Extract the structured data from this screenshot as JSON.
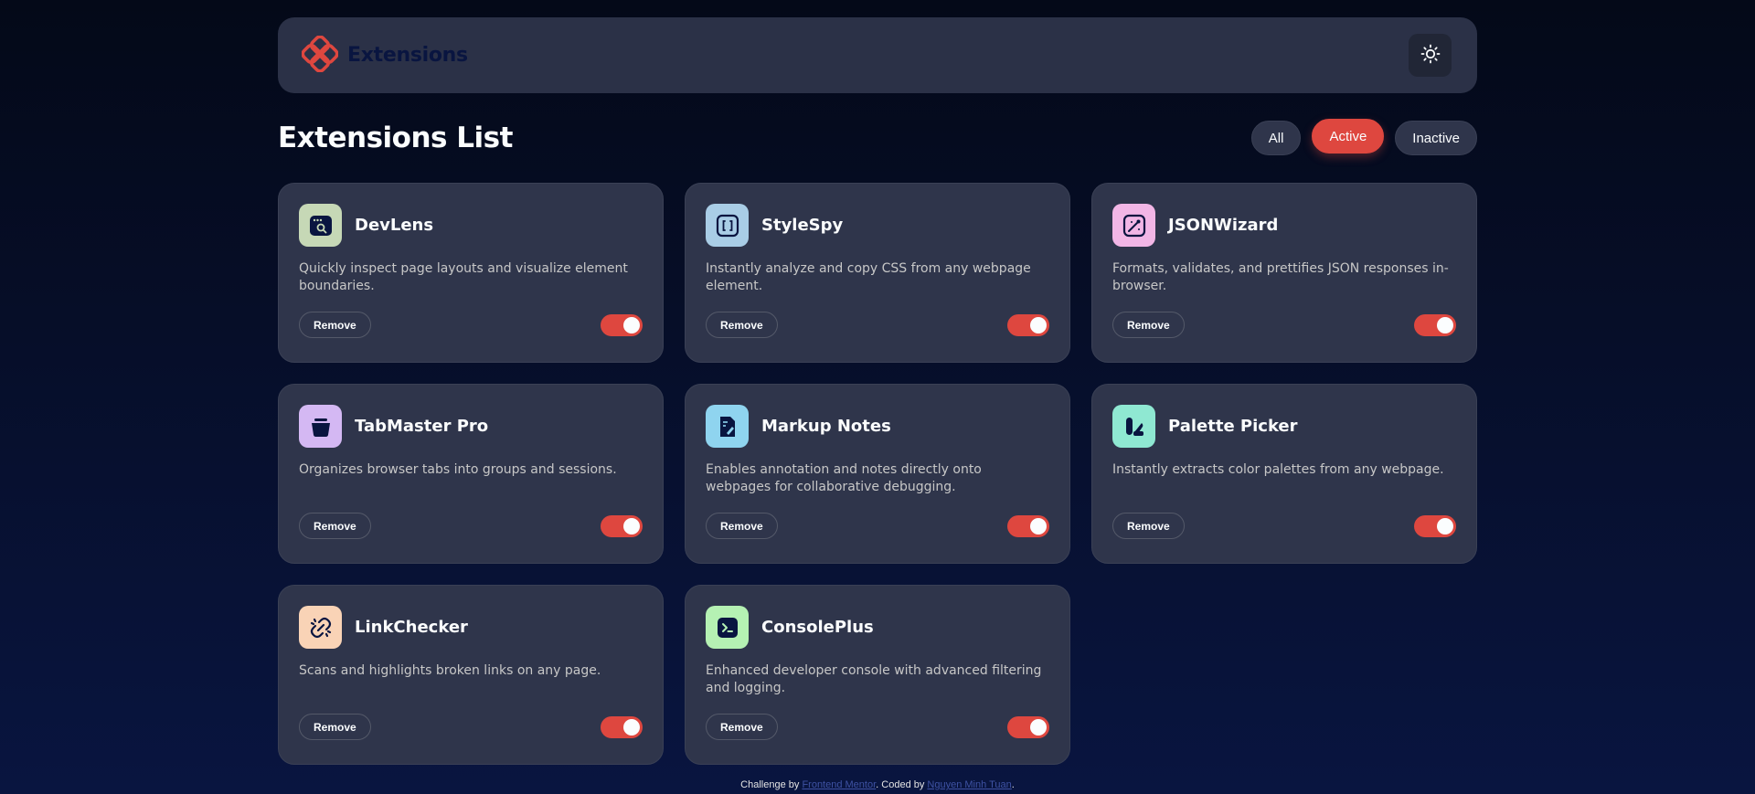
{
  "header": {
    "brand": "Extensions",
    "logo_icon": "extensions-logo-icon",
    "theme_icon": "sun-icon"
  },
  "page": {
    "title": "Extensions List"
  },
  "filters": [
    {
      "label": "All",
      "active": false
    },
    {
      "label": "Active",
      "active": true
    },
    {
      "label": "Inactive",
      "active": false
    }
  ],
  "extensions": [
    {
      "name": "DevLens",
      "description": "Quickly inspect page layouts and visualize element boundaries.",
      "icon": "devlens-icon",
      "icon_bg": "#c6d8b6",
      "active": true,
      "remove_label": "Remove"
    },
    {
      "name": "StyleSpy",
      "description": "Instantly analyze and copy CSS from any webpage element.",
      "icon": "stylespy-icon",
      "icon_bg": "#a9cde6",
      "active": true,
      "remove_label": "Remove"
    },
    {
      "name": "JSONWizard",
      "description": "Formats, validates, and prettifies JSON responses in-browser.",
      "icon": "jsonwizard-icon",
      "icon_bg": "#f2b6e6",
      "active": true,
      "remove_label": "Remove"
    },
    {
      "name": "TabMaster Pro",
      "description": "Organizes browser tabs into groups and sessions.",
      "icon": "tabmaster-icon",
      "icon_bg": "#d4b8f3",
      "active": true,
      "remove_label": "Remove"
    },
    {
      "name": "Markup Notes",
      "description": "Enables annotation and notes directly onto webpages for collaborative debugging.",
      "icon": "markup-notes-icon",
      "icon_bg": "#8fd4ef",
      "active": true,
      "remove_label": "Remove"
    },
    {
      "name": "Palette Picker",
      "description": "Instantly extracts color palettes from any webpage.",
      "icon": "palette-picker-icon",
      "icon_bg": "#8fe8d2",
      "active": true,
      "remove_label": "Remove"
    },
    {
      "name": "LinkChecker",
      "description": "Scans and highlights broken links on any page.",
      "icon": "linkchecker-icon",
      "icon_bg": "#f9d3b6",
      "active": true,
      "remove_label": "Remove"
    },
    {
      "name": "ConsolePlus",
      "description": "Enhanced developer console with advanced filtering and logging.",
      "icon": "consoleplus-icon",
      "icon_bg": "#b5f1b3",
      "active": true,
      "remove_label": "Remove"
    }
  ],
  "footer": {
    "prefix": "Challenge by ",
    "link1": "Frontend Mentor",
    "middle": ". Coded by ",
    "link2": "Nguyen Minh Tuan",
    "suffix": "."
  },
  "colors": {
    "accent": "#de473f",
    "card_bg": "#2f354b",
    "brand_text": "#091540"
  }
}
